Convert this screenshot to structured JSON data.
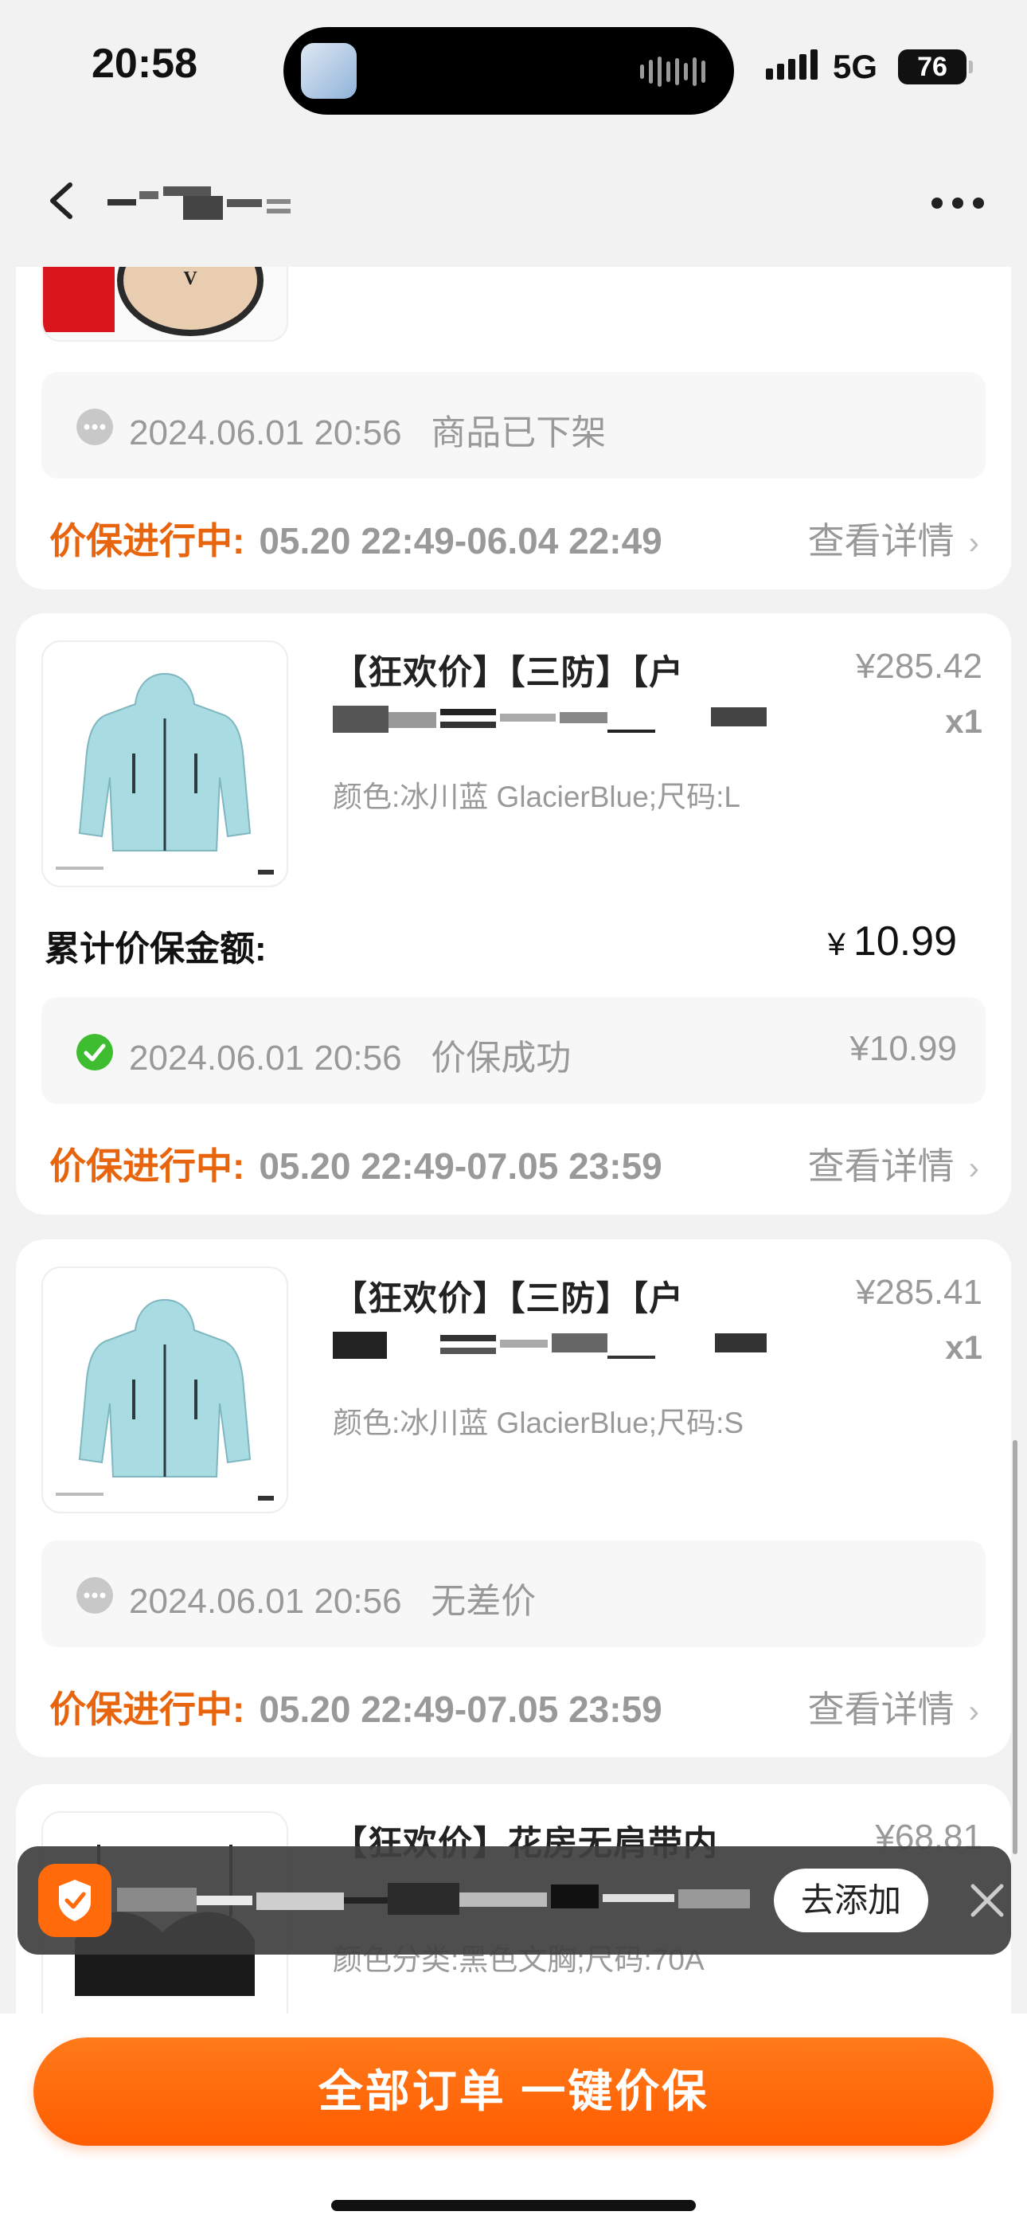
{
  "status_bar": {
    "time": "20:58",
    "network": "5G",
    "battery": "76"
  },
  "nav": {
    "title_redacted": ""
  },
  "orders": [
    {
      "status_time": "2024.06.01 20:56",
      "status_text": "商品已下架",
      "protect_label": "价保进行中:",
      "protect_range": "05.20 22:49-06.04 22:49",
      "detail_label": "查看详情"
    },
    {
      "title": "【狂欢价】【三防】【户",
      "price": "¥285.42",
      "qty": "x1",
      "spec": "颜色:冰川蓝 GlacierBlue;尺码:L",
      "cumulative_label": "累计价保金额:",
      "cumulative_currency": "¥",
      "cumulative_amount": "10.99",
      "status_time": "2024.06.01 20:56",
      "status_text": "价保成功",
      "status_amount": "¥10.99",
      "protect_label": "价保进行中:",
      "protect_range": "05.20 22:49-07.05 23:59",
      "detail_label": "查看详情"
    },
    {
      "title": "【狂欢价】【三防】【户",
      "price": "¥285.41",
      "qty": "x1",
      "spec": "颜色:冰川蓝 GlacierBlue;尺码:S",
      "status_time": "2024.06.01 20:56",
      "status_text": "无差价",
      "protect_label": "价保进行中:",
      "protect_range": "05.20 22:49-07.05 23:59",
      "detail_label": "查看详情"
    },
    {
      "title": "【狂欢价】花房无肩带内",
      "price": "¥68.81",
      "spec": "颜色分类:黑色文胸;尺码:70A"
    }
  ],
  "toast": {
    "button_label": "去添加"
  },
  "bottom": {
    "cta_label": "全部订单 一键价保"
  },
  "colors": {
    "accent": "#e9650d",
    "cta": "#ff6a0a",
    "success": "#3fbd31"
  },
  "icons": [
    "back-arrow-icon",
    "more-dots-icon",
    "clock-dots-icon",
    "check-circle-icon",
    "chevron-right-icon",
    "shield-check-icon",
    "close-icon"
  ]
}
